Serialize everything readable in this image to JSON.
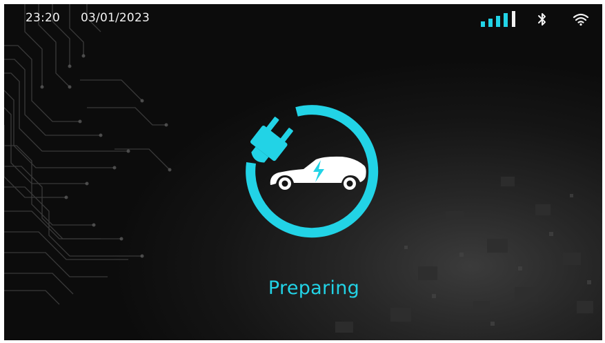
{
  "status_bar": {
    "time": "23:20",
    "date": "03/01/2023",
    "icons": [
      "signal-strength-icon",
      "bluetooth-icon",
      "wifi-icon"
    ]
  },
  "charging": {
    "status": "Preparing",
    "icon": "ev-plug-car-icon"
  },
  "colors": {
    "accent": "#22d3e6",
    "text": "#f2f2f2",
    "background": "#0c0c0c"
  }
}
